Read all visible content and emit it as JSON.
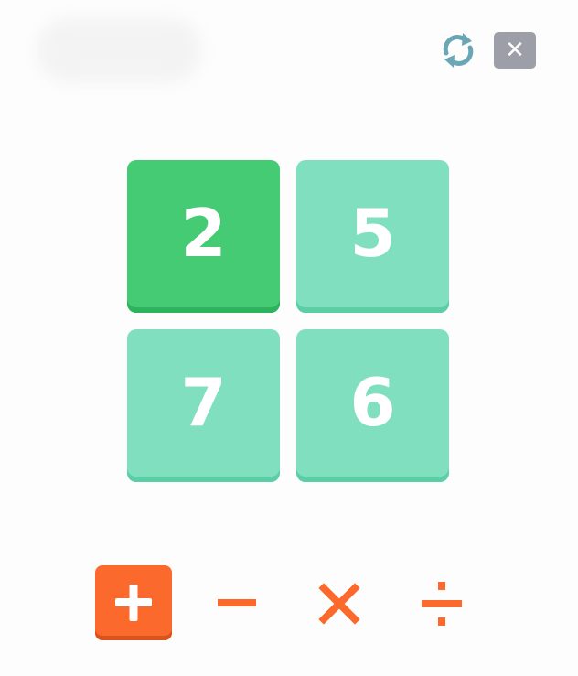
{
  "controls": {
    "refresh_icon": "refresh-icon",
    "close_label": "✕",
    "close_icon": "close-icon"
  },
  "tiles": [
    {
      "value": "2",
      "state": "selected"
    },
    {
      "value": "5",
      "state": "normal"
    },
    {
      "value": "7",
      "state": "normal"
    },
    {
      "value": "6",
      "state": "normal"
    }
  ],
  "operators": [
    {
      "symbol": "plus",
      "state": "selected"
    },
    {
      "symbol": "minus",
      "state": "normal"
    },
    {
      "symbol": "multiply",
      "state": "normal"
    },
    {
      "symbol": "divide",
      "state": "normal"
    }
  ],
  "colors": {
    "tile_selected": "#45cb73",
    "tile_normal": "#80dfbf",
    "operator_accent": "#fb6a2c",
    "close_button": "#9c9ea8",
    "refresh_icon": "#6aa6b4"
  }
}
